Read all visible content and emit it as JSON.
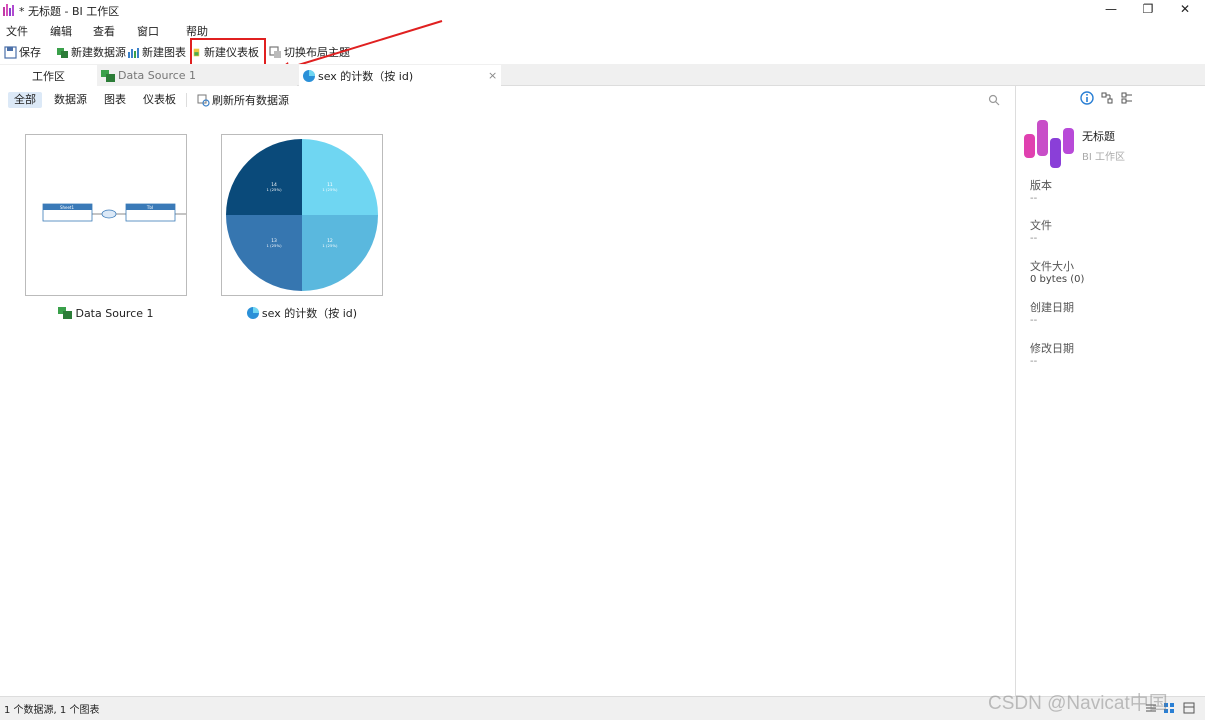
{
  "window": {
    "title": "* 无标题 - BI 工作区",
    "minimize": "—",
    "maximize": "❐",
    "close": "✕"
  },
  "menu": [
    "文件",
    "编辑",
    "查看",
    "窗口",
    "帮助"
  ],
  "toolbar": {
    "save": "保存",
    "new_datasource": "新建数据源",
    "new_chart": "新建图表",
    "new_dashboard": "新建仪表板",
    "switch_theme": "切换布局主题"
  },
  "tabs": {
    "workspace": "工作区",
    "datasource": "Data Source 1",
    "chart": "sex 的计数（按 id)",
    "close": "×"
  },
  "filters": [
    "全部",
    "数据源",
    "图表",
    "仪表板"
  ],
  "refresh_all": "刷新所有数据源",
  "cards": {
    "datasource": {
      "label": "Data Source 1",
      "node_left": "Sheet1",
      "node_right": "TbI"
    },
    "chart": {
      "label": "sex 的计数（按 id)",
      "slices": [
        {
          "name": "14",
          "detail": "1 (25%)",
          "color": "#0a4a7a"
        },
        {
          "name": "11",
          "detail": "1 (25%)",
          "color": "#6fd6f2"
        },
        {
          "name": "12",
          "detail": "1 (25%)",
          "color": "#5ab8de"
        },
        {
          "name": "13",
          "detail": "1 (25%)",
          "color": "#3676b0"
        }
      ]
    }
  },
  "right_panel": {
    "name": "无标题",
    "subtitle": "BI 工作区",
    "fields": [
      {
        "label": "版本",
        "value": "--"
      },
      {
        "label": "文件",
        "value": "--"
      },
      {
        "label": "文件大小",
        "value": "0 bytes (0)"
      },
      {
        "label": "创建日期",
        "value": "--"
      },
      {
        "label": "修改日期",
        "value": "--"
      }
    ]
  },
  "status": "1 个数据源, 1 个图表",
  "watermark": "CSDN @Navicat中国",
  "colors": {
    "accent": "#2a7fd4",
    "highlight": "#e02020",
    "active_filter": "#dce9f7"
  }
}
